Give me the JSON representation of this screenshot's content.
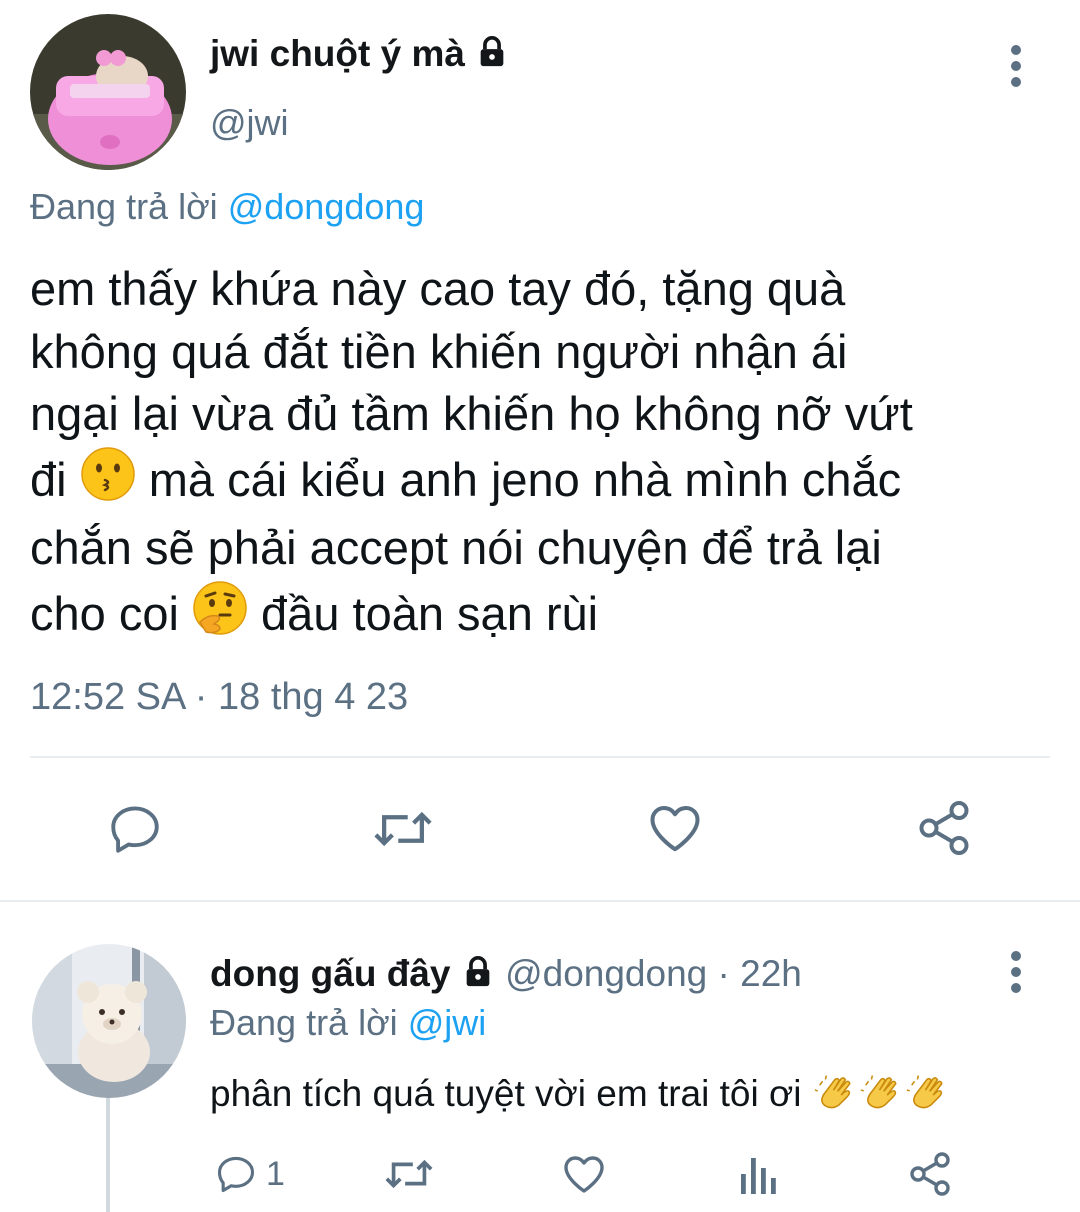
{
  "main_tweet": {
    "display_name": "jwi chuột ý mà",
    "handle": "@jwi",
    "reply_prefix": "Đang trả lời",
    "reply_to": "@dongdong",
    "text_lines": [
      "em thấy khứa này cao tay đó, tặng quà",
      "không quá đắt tiền khiến người nhận ái",
      "ngại lại vừa đủ tầm khiến họ không nỡ vứt"
    ],
    "line4_a": "đi",
    "line4_b": "mà cái kiểu anh jeno nhà mình chắc",
    "line5": "chắn sẽ phải accept nói chuyện để trả lại",
    "line6_a": "cho coi",
    "line6_b": "đầu toàn sạn rùi",
    "timestamp": "12:52 SA · 18 thg 4 23",
    "actions": [
      "reply-icon",
      "retweet-icon",
      "like-icon",
      "share-icon"
    ]
  },
  "reply_tweet": {
    "display_name": "dong gấu đây",
    "handle_time": "@dongdong · 22h",
    "reply_prefix": "Đang trả lời",
    "reply_to": "@jwi",
    "text": "phân tích quá tuyệt vời em trai tôi ơi",
    "reply_count": "1",
    "actions": [
      "reply-icon",
      "retweet-icon",
      "like-icon",
      "analytics-icon",
      "share-icon"
    ]
  },
  "colors": {
    "link": "#1da1f2",
    "muted": "#5b7083",
    "text": "#0f1419",
    "divider": "#e6ecf0"
  }
}
